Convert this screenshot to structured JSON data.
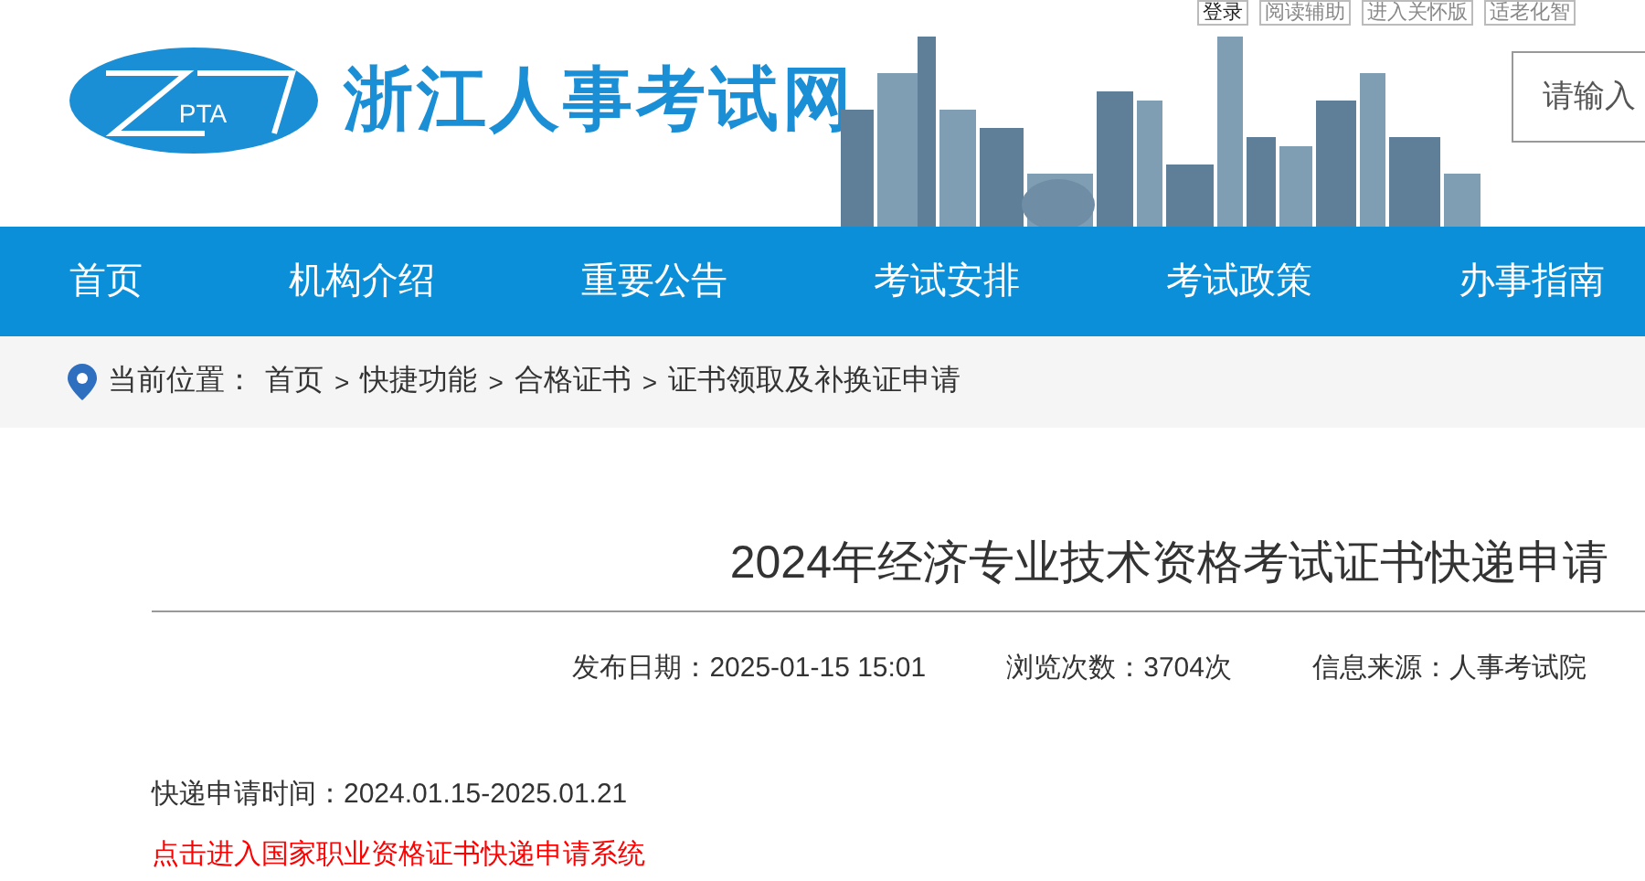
{
  "top_links": [
    "登录",
    "阅读辅助",
    "进入关怀版",
    "适老化智"
  ],
  "logo": {
    "mark": "PTA",
    "site_name": "浙江人事考试网"
  },
  "search": {
    "placeholder": "请输入"
  },
  "nav": [
    {
      "label": "首页",
      "selected": false
    },
    {
      "label": "机构介绍",
      "selected": false
    },
    {
      "label": "重要公告",
      "selected": false
    },
    {
      "label": "考试安排",
      "selected": false
    },
    {
      "label": "考试政策",
      "selected": false
    },
    {
      "label": "办事指南",
      "selected": false
    }
  ],
  "breadcrumb": {
    "label": "当前位置：",
    "items": [
      "首页",
      "快捷功能",
      "合格证书",
      "证书领取及补换证申请"
    ],
    "separators": [
      ">",
      ">",
      ">"
    ]
  },
  "article": {
    "title": "2024年经济专业技术资格考试证书快递申请",
    "meta": [
      "发布日期：2025-01-15 15:01",
      "浏览次数：3704次",
      "信息来源：人事考试院"
    ],
    "body": "快递申请时间：2024.01.15-2025.01.21",
    "link": "点击进入国家职业资格证书快递申请系统"
  }
}
